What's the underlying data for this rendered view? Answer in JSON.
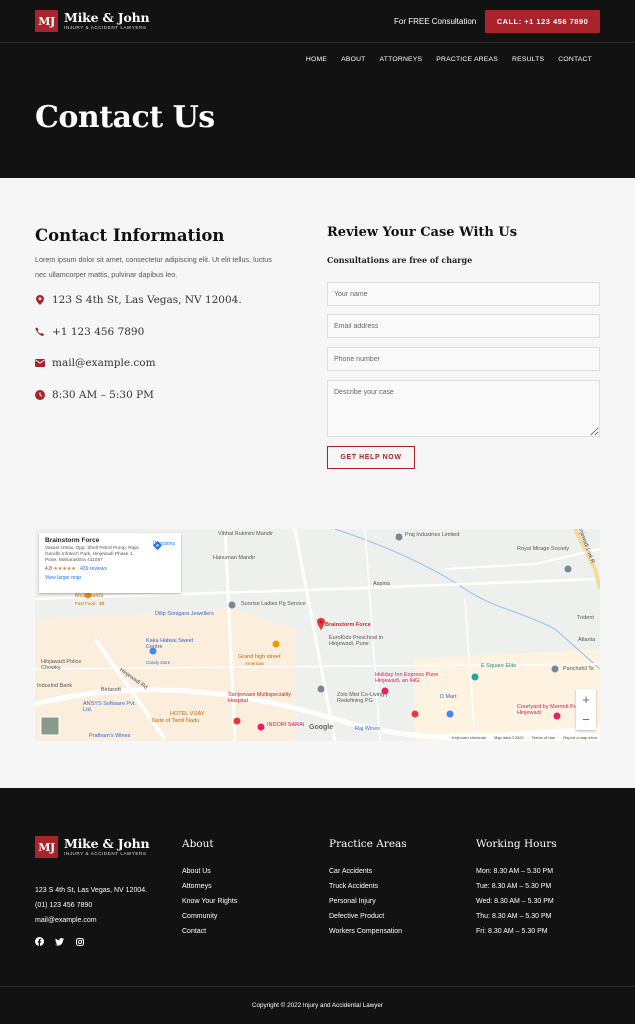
{
  "header": {
    "logo_mark": "MJ",
    "logo_name": "Mike & John",
    "logo_sub": "INJURY & ACCIDENT LAWYERS",
    "free_consult": "For FREE Consultation",
    "call_button": "CALL: +1 123 456 7890",
    "nav": [
      "HOME",
      "ABOUT",
      "ATTORNEYS",
      "PRACTICE AREAS",
      "RESULTS",
      "CONTACT"
    ],
    "page_title": "Contact Us"
  },
  "contact_info": {
    "title": "Contact Information",
    "description": "Lorem ipsum dolor sit amet, consectetur adipiscing elit. Ut elit tellus, luctus nec ullamcorper mattis, pulvinar dapibus leo.",
    "address": "123 S 4th St, Las Vegas, NV 12004.",
    "phone": "+1 123 456 7890",
    "email": "mail@example.com",
    "hours": "8:30 AM – 5:30 PM"
  },
  "review": {
    "title": "Review Your Case With Us",
    "subtitle": "Consultations are free of charge",
    "name_placeholder": "Your name",
    "email_placeholder": "Email address",
    "phone_placeholder": "Phone number",
    "case_placeholder": "Describe your case",
    "submit": "GET HELP NOW"
  },
  "map": {
    "place_name": "Brainstorm Force",
    "place_address": "Vasant Utsav, Opp. Shell Petrol Pump, Rajiv Gandhi Infotech Park, Hinjewadi Phase 1, Pune, Maharashtra 411057",
    "rating": "4.8",
    "stars": "★★★★★",
    "reviews": "439 reviews",
    "directions": "Directions",
    "larger_map": "View larger map",
    "labels": {
      "vitthal": "Vitthal Rukmini Mandir",
      "praj": "Praj Industries Limited",
      "royal": "Royal Mirage Society",
      "hanuman": "Hanuman Mandir",
      "mcdonalds": "McDonald's",
      "mcdonalds_sub": "Fast Food · $$",
      "aspiria": "Aspiria",
      "dilip": "Dilip Sonigara Jewellers",
      "sunrise": "Sunrise Ladies Pg Service",
      "brainstorm": "Brainstorm Force",
      "trident": "Trident",
      "kaka": "Kaka Halwai Sweet Centre",
      "kaka_sub": "Candy store",
      "grand": "Grand high street",
      "grand_sub": "American",
      "eurokids": "EuroKids Preschool in Hinjewadi, Pune",
      "atlanta": "Atlanta",
      "police": "Hinjawadi Police Chowky",
      "esquare": "E Square Elite",
      "panchshil": "Panchshil Te",
      "indusind": "IndusInd Bank",
      "birlasoft": "Birlasoft",
      "holiday": "Holiday Inn Express Pune Hinjewadi, an IHG",
      "ansys": "ANSYS Software Pvt. Ltd.",
      "sanjeevani": "Sanjeevani Multispeciality Hospital",
      "zolo": "Zolo Mist Co-Living | Redefining PG",
      "dmart": "D Mart",
      "courtyard": "Courtyard by Marriott Pune Hinjewadi",
      "hotel_vijay": "HOTEL VIJAY",
      "hotel_vijay_sub": "Taste of Tamil Nadu",
      "indori": "INDORI SARAI",
      "rajwines": "Raj Wines",
      "prathams": "Pratham's Wines",
      "road": "Hinjewadi Rd",
      "link_road": "Hinjewadi Link R"
    },
    "google": "Google",
    "footer_items": [
      "Keyboard shortcuts",
      "Map data ©2022",
      "Terms of Use",
      "Report a map error"
    ],
    "zoom_in": "+",
    "zoom_out": "−"
  },
  "footer": {
    "address": "123 S 4th St, Las Vegas, NV 12004.",
    "phone": "(01) 123 456 7890",
    "email": "mail@example.com",
    "about_title": "About",
    "about_links": [
      "About Us",
      "Attorneys",
      "Know Your Rights",
      "Community",
      "Contact"
    ],
    "practice_title": "Practice Areas",
    "practice_links": [
      "Car Accidents",
      "Truck Accidents",
      "Personal Injury",
      "Defective Product",
      "Workers Compensation"
    ],
    "hours_title": "Working Hours",
    "hours": [
      "Mon: 8.30 AM – 5.30 PM",
      "Tue: 8.30 AM – 5.30 PM",
      "Wed: 8.30 AM – 5.30 PM",
      "Thu: 8.30 AM – 5.30 PM",
      "Fri: 8.30 AM – 5.30 PM"
    ],
    "copyright": "Copyright © 2022 Injury and Accidental Lawyer"
  },
  "colors": {
    "accent": "#a8232b",
    "dark": "#121212",
    "light_bg": "#f6f6f6"
  }
}
